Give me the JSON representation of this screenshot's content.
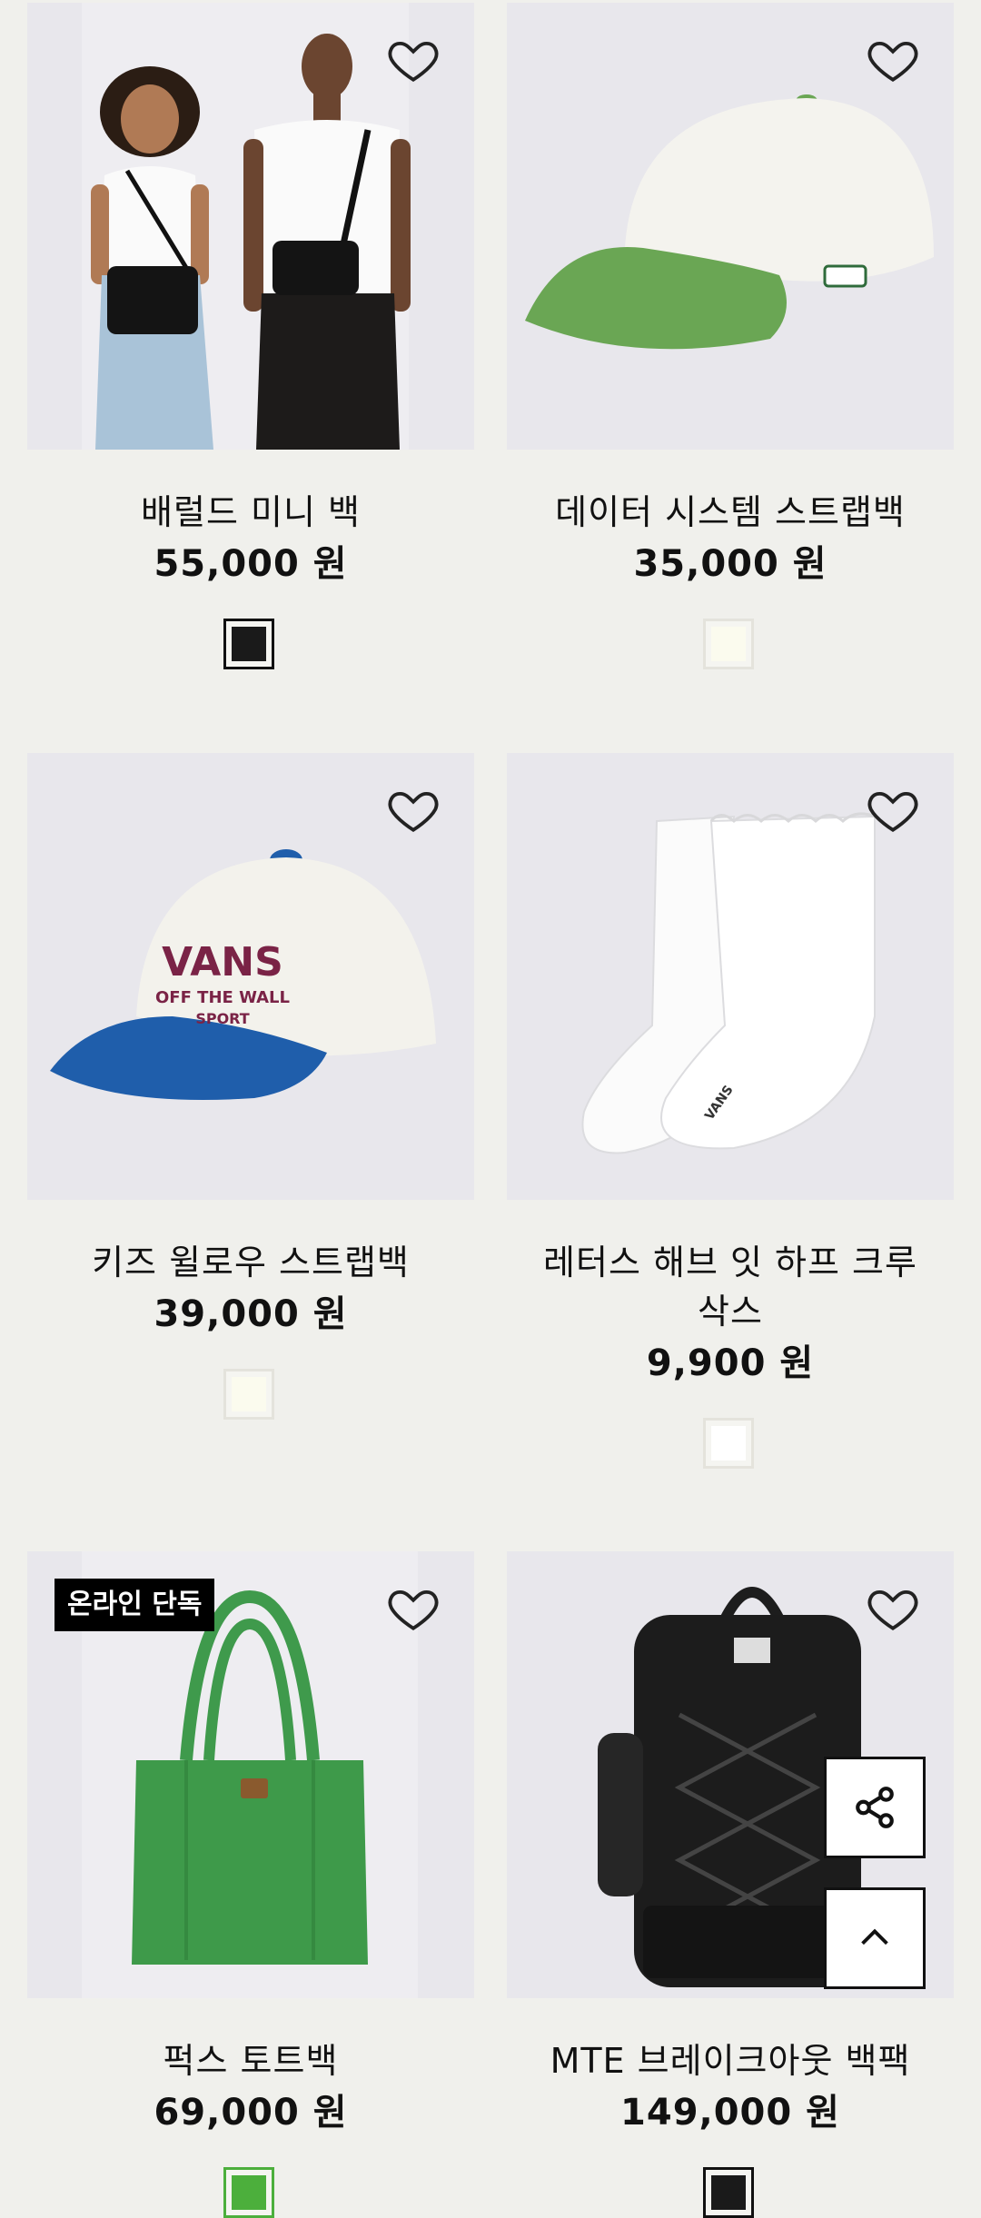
{
  "products": [
    {
      "name": "배럴드 미니 백",
      "price": "55,000 원",
      "swatch_color": "#1a1a1a",
      "image": "models-with-crossbody-bag",
      "favorite_icon": "heart-outline-icon"
    },
    {
      "name": "데이터 시스템 스트랩백",
      "price": "35,000 원",
      "swatch_color": "#fbfbee",
      "image": "white-cap-green-brim",
      "favorite_icon": "heart-outline-icon"
    },
    {
      "name": "키즈 윌로우 스트랩백",
      "price": "39,000 원",
      "swatch_color": "#fbfbee",
      "image": "white-cap-blue-brim",
      "favorite_icon": "heart-outline-icon"
    },
    {
      "name_line1": "레터스 해브 잇 하프 크루",
      "name_line2": "삭스",
      "price": "9,900 원",
      "swatch_color": "#ffffff",
      "image": "white-crew-socks",
      "favorite_icon": "heart-outline-icon"
    },
    {
      "name": "퍽스 토트백",
      "price": "69,000 원",
      "badge": "온라인 단독",
      "swatch_color": "#4caf3c",
      "image": "green-tote-bag",
      "favorite_icon": "heart-outline-icon"
    },
    {
      "name": "MTE 브레이크아웃 백팩",
      "price": "149,000 원",
      "swatch_color": "#1a1a1a",
      "image": "black-backpack",
      "favorite_icon": "heart-outline-icon"
    }
  ],
  "floating_buttons": {
    "share_icon": "share-icon",
    "top_icon": "chevron-up-icon"
  },
  "colors": {
    "page_bg": "#f0f0ec",
    "image_bg": "#e6e5ea",
    "text": "#111111"
  }
}
